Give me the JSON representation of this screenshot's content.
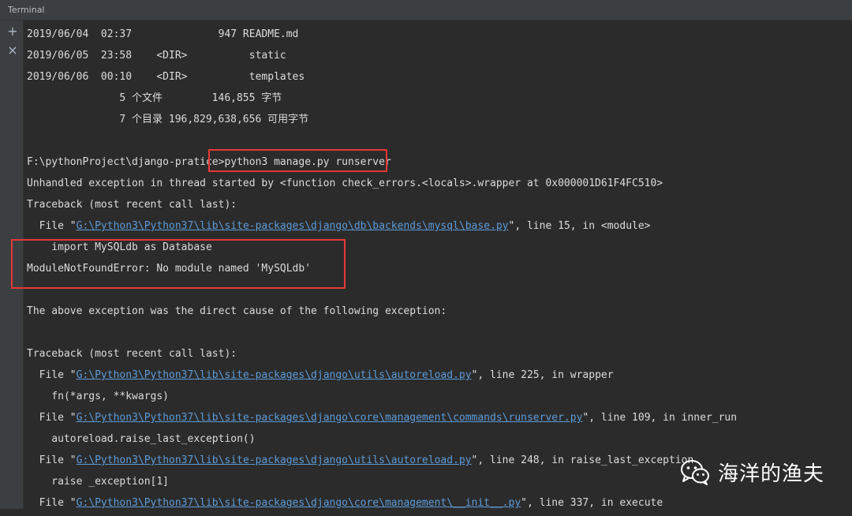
{
  "window": {
    "title": "Terminal"
  },
  "gutter": {
    "add_icon": "+",
    "close_icon": "×"
  },
  "lines": [
    [
      "2019/06/04  02:37              947 README.md"
    ],
    [
      "2019/06/05  23:58    <DIR>          static"
    ],
    [
      "2019/06/06  00:10    <DIR>          templates"
    ],
    [
      "               5 个文件        146,855 字节"
    ],
    [
      "               7 个目录 196,829,638,656 可用字节"
    ],
    [
      ""
    ],
    [
      "F:\\pythonProject\\django-pratice>python3 manage.py runserver"
    ],
    [
      "Unhandled exception in thread started by <function check_errors.<locals>.wrapper at 0x000001D61F4FC510>"
    ],
    [
      "Traceback (most recent call last):"
    ],
    [
      "  File \"",
      "G:\\Python3\\Python37\\lib\\site-packages\\django\\db\\backends\\mysql\\base.py",
      "\", line 15, in <module>"
    ],
    [
      "    import MySQLdb as Database"
    ],
    [
      "ModuleNotFoundError: No module named 'MySQLdb'"
    ],
    [
      ""
    ],
    [
      "The above exception was the direct cause of the following exception:"
    ],
    [
      ""
    ],
    [
      "Traceback (most recent call last):"
    ],
    [
      "  File \"",
      "G:\\Python3\\Python37\\lib\\site-packages\\django\\utils\\autoreload.py",
      "\", line 225, in wrapper"
    ],
    [
      "    fn(*args, **kwargs)"
    ],
    [
      "  File \"",
      "G:\\Python3\\Python37\\lib\\site-packages\\django\\core\\management\\commands\\runserver.py",
      "\", line 109, in inner_run"
    ],
    [
      "    autoreload.raise_last_exception()"
    ],
    [
      "  File \"",
      "G:\\Python3\\Python37\\lib\\site-packages\\django\\utils\\autoreload.py",
      "\", line 248, in raise_last_exception"
    ],
    [
      "    raise _exception[1]"
    ],
    [
      "  File \"",
      "G:\\Python3\\Python37\\lib\\site-packages\\django\\core\\management\\__init__.py",
      "\", line 337, in execute"
    ]
  ],
  "watermark": {
    "text": "海洋的渔夫",
    "icon": "wechat-icon"
  },
  "colors": {
    "background": "#2b2b2b",
    "text": "#dcdcdc",
    "link": "#5c9bd8",
    "highlight_box": "#e53935"
  }
}
